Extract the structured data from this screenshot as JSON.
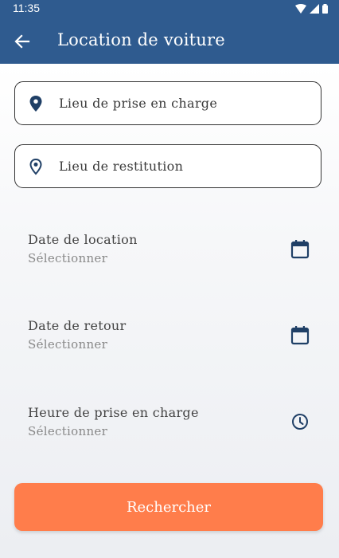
{
  "status_bar": {
    "time": "11:35"
  },
  "app_bar": {
    "title": "Location de voiture"
  },
  "pickup_field": {
    "placeholder": "Lieu de prise en charge"
  },
  "return_field": {
    "placeholder": "Lieu de restitution"
  },
  "rows": [
    {
      "label": "Date de location",
      "value": "Sélectionner",
      "icon": "calendar-icon"
    },
    {
      "label": "Date de retour",
      "value": "Sélectionner",
      "icon": "calendar-icon"
    },
    {
      "label": "Heure de prise en charge",
      "value": "Sélectionner",
      "icon": "clock-icon"
    }
  ],
  "search_button": {
    "label": "Rechercher"
  },
  "colors": {
    "app_bar": "#2f5b8f",
    "accent": "#ff7d4b",
    "icon": "#1f3f66"
  }
}
